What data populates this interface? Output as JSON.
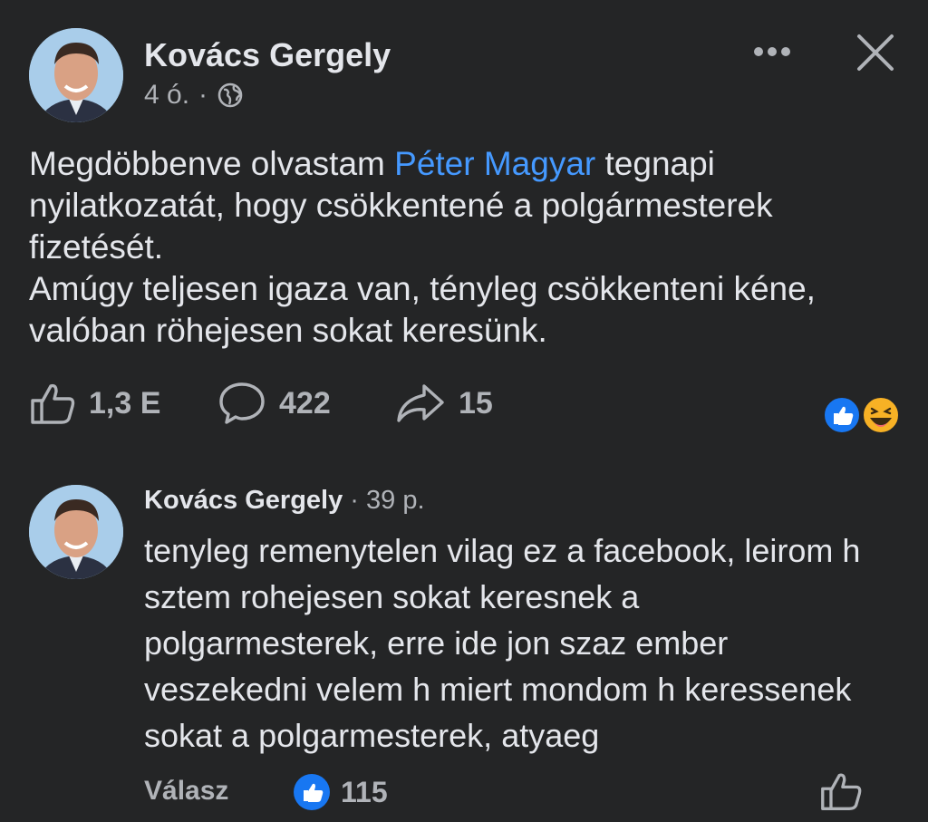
{
  "post": {
    "author": "Kovács Gergely",
    "time": "4 ó.",
    "dot": "·",
    "text_before_link": "Megdöbbenve olvastam ",
    "link_text": "Péter Magyar",
    "text_after_link": " tegnapi nyilatkozatát, hogy csökkentené a polgármesterek fizetését.",
    "text_second": "Amúgy teljesen igaza van, tényleg csökkenteni kéne, valóban röhejesen sokat keresünk.",
    "actions": {
      "likes": "1,3 E",
      "comments": "422",
      "shares": "15"
    },
    "reaction_icons": [
      "like-reaction-icon",
      "haha-reaction-icon"
    ]
  },
  "comment": {
    "author": "Kovács Gergely",
    "separator": " · ",
    "time": "39 p.",
    "text": "tenyleg remenytelen vilag ez a facebook, leirom h sztem rohejesen sokat keresnek a polgarmesterek, erre ide jon szaz ember veszekedni velem h miert mondom h keressenek sokat a polgarmesterek, atyaeg",
    "reply_label": "Válasz",
    "reaction_count": "115"
  },
  "colors": {
    "background": "#242526",
    "text": "#e4e6eb",
    "secondary": "#b0b3b8",
    "link": "#4599ff",
    "like_blue": "#1877f2",
    "haha_yellow": "#f7b125"
  }
}
